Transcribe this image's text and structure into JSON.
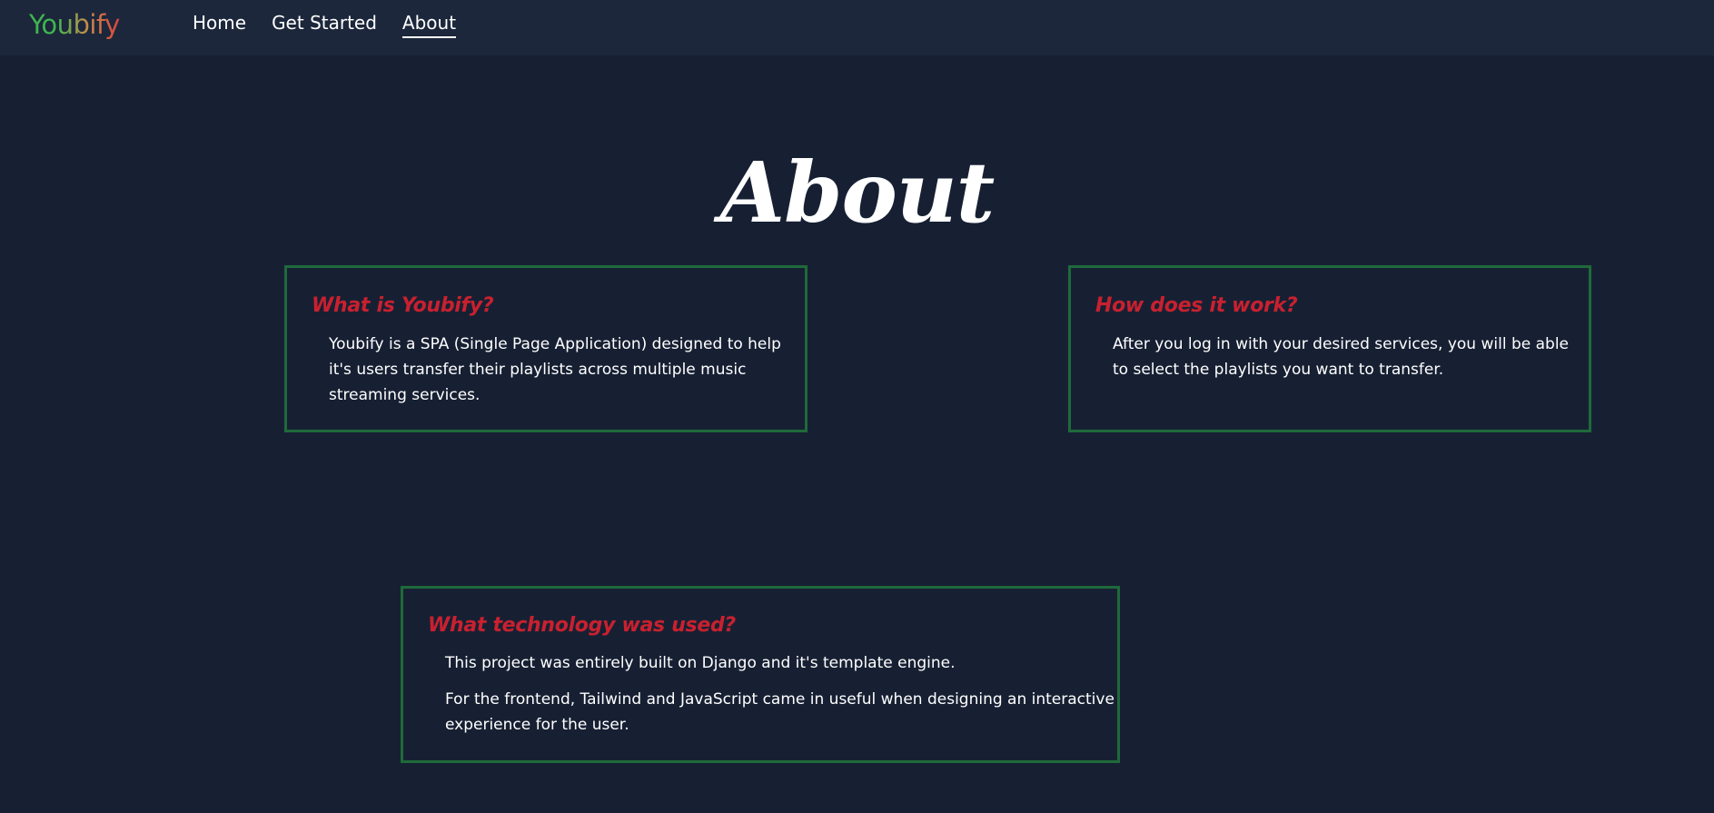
{
  "nav": {
    "logo": "Youbify",
    "links": [
      "Home",
      "Get Started",
      "About"
    ],
    "active": "About"
  },
  "page": {
    "title": "About"
  },
  "cards": [
    {
      "title": "What is Youbify?",
      "paragraphs": [
        "Youbify is a SPA (Single Page Application) designed to help it's users transfer their playlists across multiple music streaming services."
      ]
    },
    {
      "title": "How does it work?",
      "paragraphs": [
        "After you log in with your desired services, you will be able to select the playlists you want to transfer."
      ]
    },
    {
      "title": "What technology was used?",
      "paragraphs": [
        "This project was entirely built on Django and it's template engine.",
        "For the frontend, Tailwind and JavaScript came in useful when designing an interactive experience for the user."
      ]
    }
  ],
  "colors": {
    "background": "#172033",
    "navbar": "#1c273b",
    "card_border": "#1e6a3a",
    "card_title": "#c9202f",
    "logo_green": "#3fb550",
    "logo_red": "#d9433f"
  }
}
